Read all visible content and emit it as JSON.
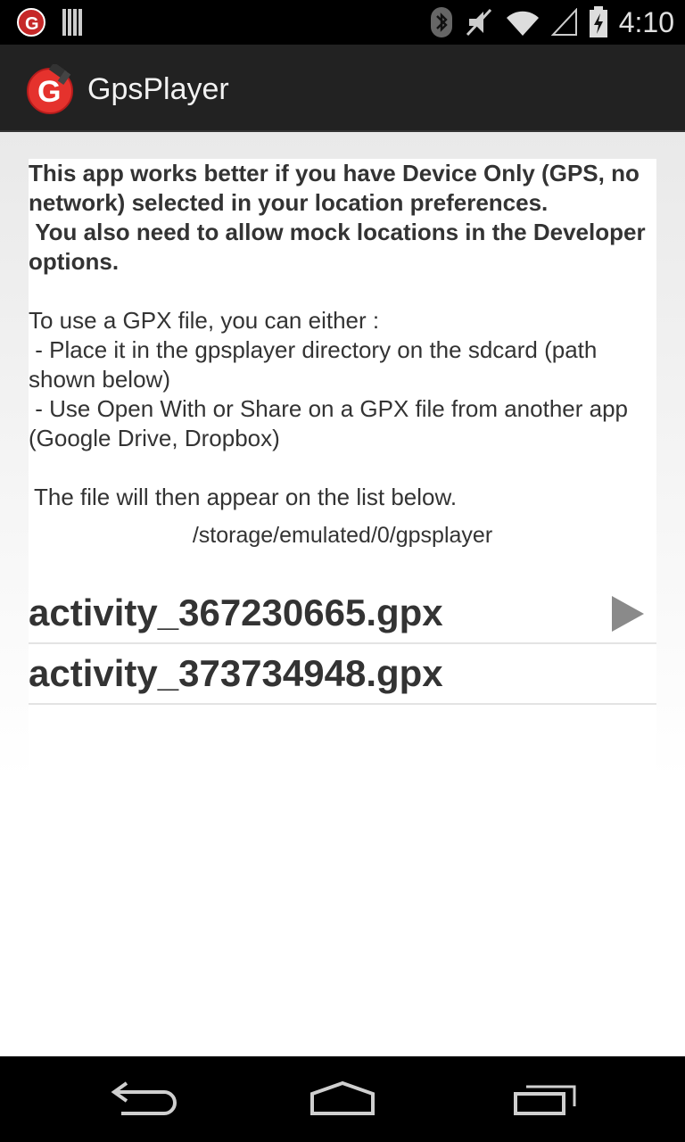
{
  "status_bar": {
    "time": "4:10",
    "icons": [
      "gpsplayer-notification-icon",
      "barcode-icon",
      "bluetooth-icon",
      "vibrate-icon",
      "wifi-icon",
      "signal-icon",
      "battery-icon"
    ]
  },
  "action_bar": {
    "title": "GpsPlayer",
    "logo_letter": "G"
  },
  "intro": {
    "warning_line1": "This app works better if you have Device Only (GPS, no network) selected in your location preferences.",
    "warning_line2": " You also need to allow mock locations in the Developer options.",
    "usage_heading": "To use a GPX file, you can either :",
    "usage_option1": " - Place it in the gpsplayer directory on the sdcard (path shown below)",
    "usage_option2": " - Use Open With or Share on a GPX file from another app (Google Drive, Dropbox)",
    "list_note": "The file will then appear on the list below."
  },
  "directory_path": "/storage/emulated/0/gpsplayer",
  "files": [
    {
      "name": "activity_367230665.gpx",
      "has_play": true
    },
    {
      "name": "activity_373734948.gpx",
      "has_play": false
    }
  ],
  "colors": {
    "accent_red": "#e5322d",
    "actionbar_bg": "#222222",
    "text": "#333333"
  }
}
